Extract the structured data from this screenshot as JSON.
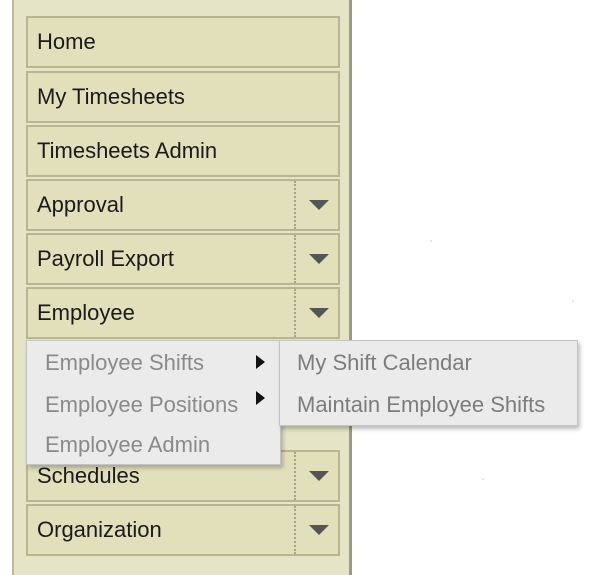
{
  "menu": {
    "items": [
      {
        "label": "Home"
      },
      {
        "label": "My Timesheets"
      },
      {
        "label": "Timesheets Admin"
      },
      {
        "label": "Approval"
      },
      {
        "label": "Payroll Export"
      },
      {
        "label": "Employee"
      },
      {
        "label": "Schedules"
      },
      {
        "label": "Organization"
      }
    ]
  },
  "employee_submenu": {
    "items": [
      {
        "label": "Employee Shifts"
      },
      {
        "label": "Employee Positions"
      },
      {
        "label": "Employee Admin"
      }
    ]
  },
  "shifts_flyout": {
    "items": [
      {
        "label": "My Shift Calendar"
      },
      {
        "label": "Maintain Employee Shifts"
      }
    ]
  },
  "colors": {
    "menu_bg": "#e2dfbb",
    "menu_border": "#b8b68f",
    "submenu_bg": "#ebebeb",
    "submenu_text": "#8a8a8a"
  },
  "icons": {
    "dropdown": "chevron-down-icon",
    "submenu_arrow": "chevron-right-icon"
  }
}
